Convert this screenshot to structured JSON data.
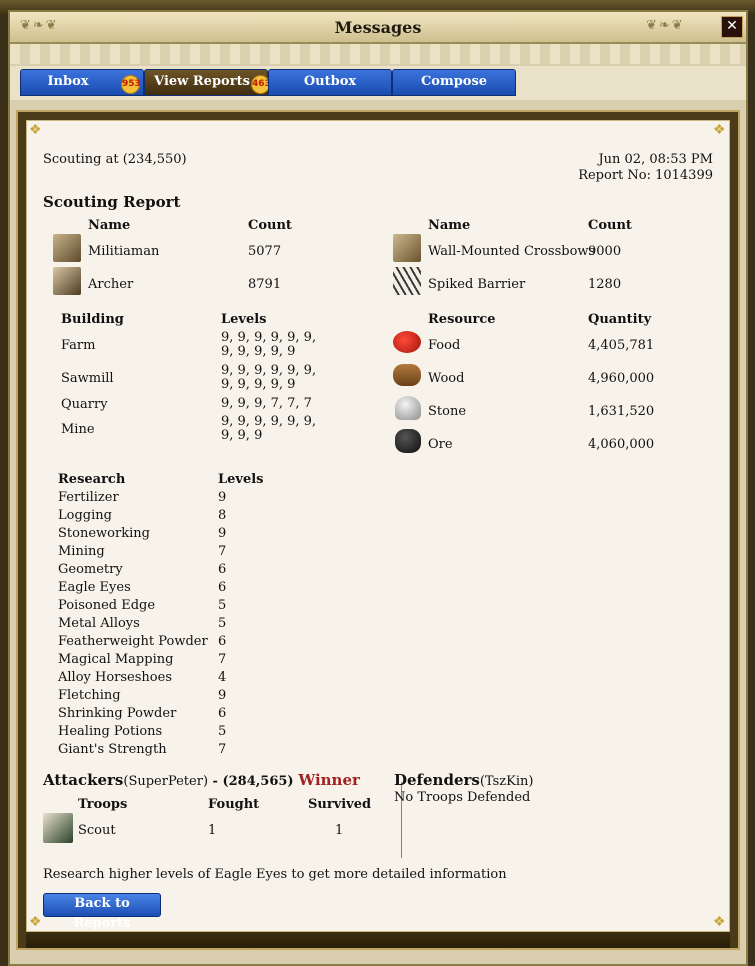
{
  "window": {
    "title": "Messages",
    "close_label": "✕"
  },
  "tabs": [
    {
      "label": "Inbox",
      "badge": "953"
    },
    {
      "label": "View Reports",
      "badge": "463"
    },
    {
      "label": "Outbox"
    },
    {
      "label": "Compose"
    }
  ],
  "report": {
    "scouting_at": "Scouting at (234,550)",
    "date": "Jun 02, 08:53 PM",
    "report_no": "Report No: 1014399",
    "heading": "Scouting Report"
  },
  "troops_table": {
    "name_header": "Name",
    "count_header": "Count",
    "rows": [
      {
        "name": "Militiaman",
        "count": "5077",
        "icon": "militiaman-icon"
      },
      {
        "name": "Archer",
        "count": "8791",
        "icon": "archer-icon"
      }
    ]
  },
  "fort_table": {
    "name_header": "Name",
    "count_header": "Count",
    "rows": [
      {
        "name": "Wall-Mounted Crossbows",
        "count": "9000",
        "icon": "crossbow-icon"
      },
      {
        "name": "Spiked Barrier",
        "count": "1280",
        "icon": "spiked-barrier-icon"
      }
    ]
  },
  "buildings": {
    "building_header": "Building",
    "levels_header": "Levels",
    "rows": [
      {
        "name": "Farm",
        "levels": "9, 9, 9, 9, 9, 9, 9, 9, 9, 9, 9"
      },
      {
        "name": "Sawmill",
        "levels": "9, 9, 9, 9, 9, 9, 9, 9, 9, 9, 9"
      },
      {
        "name": "Quarry",
        "levels": "9, 9, 9, 7, 7, 7"
      },
      {
        "name": "Mine",
        "levels": "9, 9, 9, 9, 9, 9, 9, 9, 9"
      }
    ]
  },
  "resources": {
    "resource_header": "Resource",
    "quantity_header": "Quantity",
    "rows": [
      {
        "name": "Food",
        "quantity": "4,405,781",
        "icon": "food-icon"
      },
      {
        "name": "Wood",
        "quantity": "4,960,000",
        "icon": "wood-icon"
      },
      {
        "name": "Stone",
        "quantity": "1,631,520",
        "icon": "stone-icon"
      },
      {
        "name": "Ore",
        "quantity": "4,060,000",
        "icon": "ore-icon"
      }
    ]
  },
  "research": {
    "research_header": "Research",
    "levels_header": "Levels",
    "rows": [
      {
        "name": "Fertilizer",
        "level": "9"
      },
      {
        "name": "Logging",
        "level": "8"
      },
      {
        "name": "Stoneworking",
        "level": "9"
      },
      {
        "name": "Mining",
        "level": "7"
      },
      {
        "name": "Geometry",
        "level": "6"
      },
      {
        "name": "Eagle Eyes",
        "level": "6"
      },
      {
        "name": "Poisoned Edge",
        "level": "5"
      },
      {
        "name": "Metal Alloys",
        "level": "5"
      },
      {
        "name": "Featherweight Powder",
        "level": "6"
      },
      {
        "name": "Magical Mapping",
        "level": "7"
      },
      {
        "name": "Alloy Horseshoes",
        "level": "4"
      },
      {
        "name": "Fletching",
        "level": "9"
      },
      {
        "name": "Shrinking Powder",
        "level": "6"
      },
      {
        "name": "Healing Potions",
        "level": "5"
      },
      {
        "name": "Giant's Strength",
        "level": "7"
      }
    ]
  },
  "battle": {
    "attackers_label": "Attackers",
    "attacker_name": "(SuperPeter)",
    "attacker_coords": " - (284,565)",
    "winner_label": "Winner",
    "troops_header": "Troops",
    "fought_header": "Fought",
    "survived_header": "Survived",
    "troops": [
      {
        "name": "Scout",
        "fought": "1",
        "survived": "1",
        "icon": "scout-icon"
      }
    ],
    "defenders_label": "Defenders",
    "defender_name": "(TszKin)",
    "defenders_note": "No Troops Defended"
  },
  "footer": {
    "hint": "Research higher levels of Eagle Eyes to get more detailed information",
    "back_button": "Back to Reports"
  },
  "colors": {
    "tab_blue": "#1a4cb0",
    "panel_bg": "#f7f3ea",
    "winner_red": "#a12222",
    "frame_brown": "#4a3a18"
  }
}
